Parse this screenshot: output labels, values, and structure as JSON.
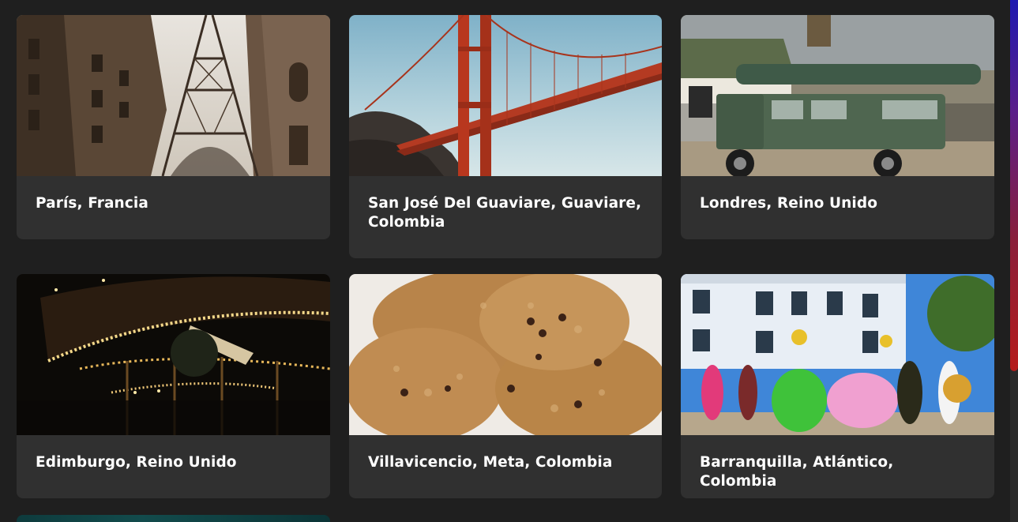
{
  "destinations": [
    {
      "label": "París, Francia",
      "image": "eiffel-tower-photo"
    },
    {
      "label": "San José Del Guaviare, Guaviare, Colombia",
      "image": "red-suspension-bridge-photo"
    },
    {
      "label": "Londres, Reino Unido",
      "image": "green-land-rover-photo"
    },
    {
      "label": "Edimburgo, Reino Unido",
      "image": "carousel-lights-photo"
    },
    {
      "label": "Villavicencio, Meta, Colombia",
      "image": "oatmeal-cookies-photo"
    },
    {
      "label": "Barranquilla, Atlántico, Colombia",
      "image": "carnival-dancers-photo"
    }
  ],
  "colors": {
    "background": "#1f1f1f",
    "card": "#303030",
    "text": "#ffffff",
    "scroll_thumb_top": "#1f1ab0",
    "scroll_thumb_bottom": "#b51b1b"
  }
}
